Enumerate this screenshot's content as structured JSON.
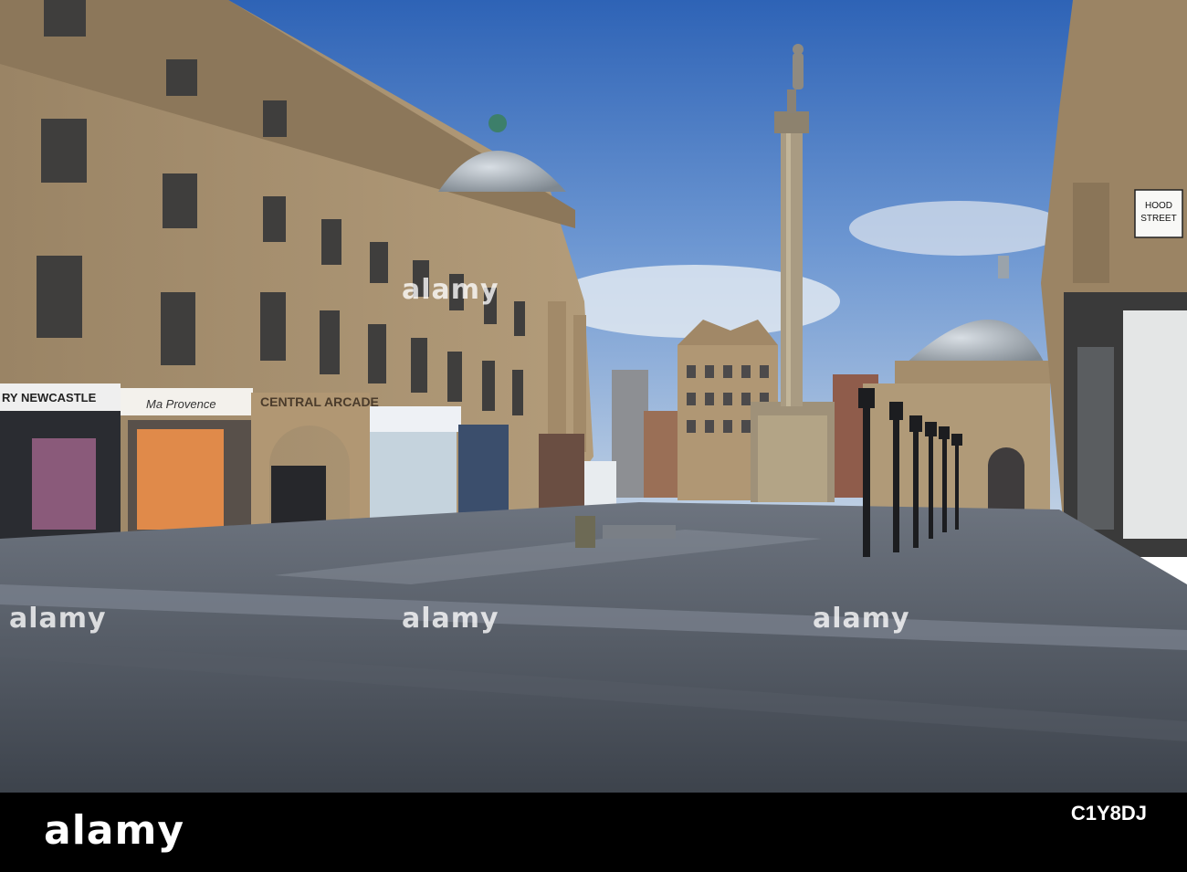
{
  "watermark": "alamy",
  "shop_signs": {
    "newcastle": "RY NEWCASTLE",
    "provence": "Ma Provence",
    "arcade": "CENTRAL ARCADE"
  },
  "street_sign": {
    "line1": "HOOD",
    "line2": "STREET"
  },
  "footer": {
    "brand": "alamy",
    "image_code": "C1Y8DJ"
  }
}
